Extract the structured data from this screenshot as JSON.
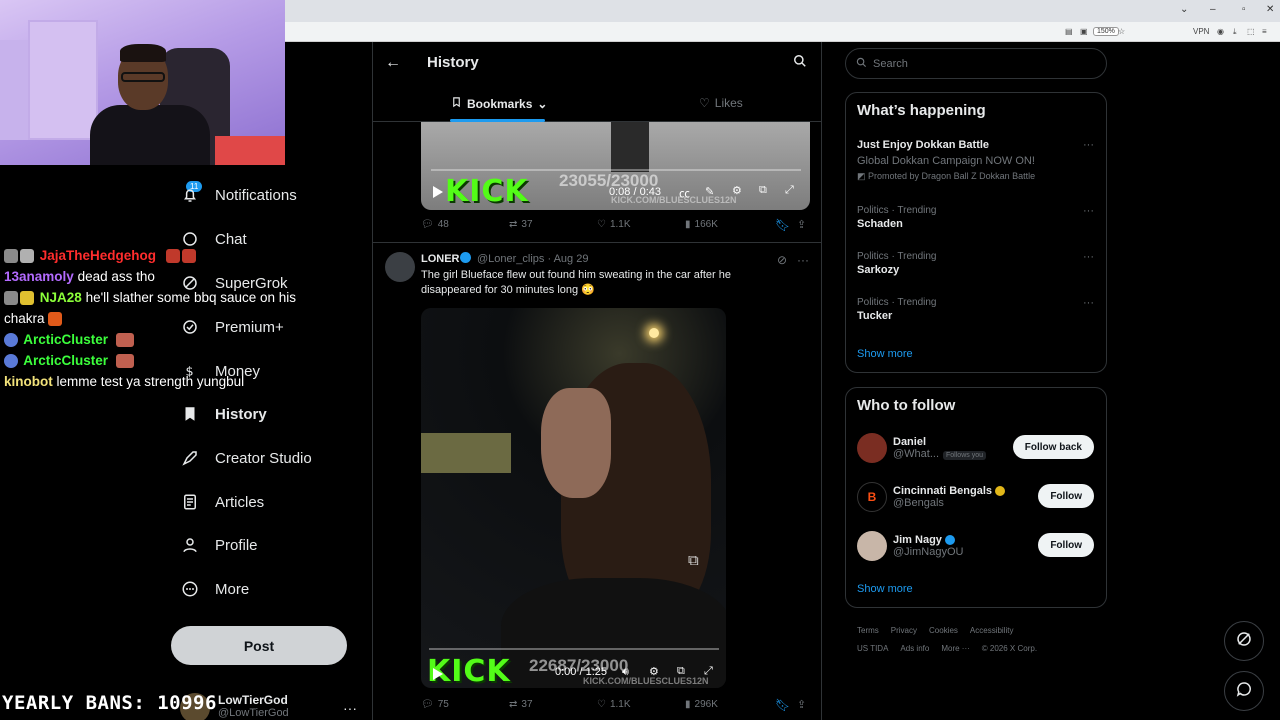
{
  "browser": {
    "zoom": "150%",
    "vpn": "VPN"
  },
  "nav": {
    "notifications_badge": "11",
    "items": [
      {
        "label": "Notifications"
      },
      {
        "label": "Chat"
      },
      {
        "label": "SuperGrok"
      },
      {
        "label": "Premium+"
      },
      {
        "label": "Money"
      },
      {
        "label": "History"
      },
      {
        "label": "Creator Studio"
      },
      {
        "label": "Articles"
      },
      {
        "label": "Profile"
      },
      {
        "label": "More"
      }
    ],
    "post_label": "Post",
    "account_name": "LowTierGod",
    "account_handle": "@LowTierGod"
  },
  "chat": [
    {
      "user": "JajaTheHedgehog",
      "color": "#ff2d2d",
      "msg": ""
    },
    {
      "user": "13anamoly",
      "color": "#b46bff",
      "msg": "dead ass tho"
    },
    {
      "user": "NJA28",
      "color": "#8cff3a",
      "msg": "he'll slather some bbq sauce on his chakra"
    },
    {
      "user": "ArcticCluster",
      "color": "#3cff3c",
      "msg": ""
    },
    {
      "user": "ArcticCluster",
      "color": "#3cff3c",
      "msg": ""
    },
    {
      "user": "kinobot",
      "color": "#f2e27a",
      "msg": "lemme test ya strength yungbul"
    }
  ],
  "bans": "YEARLY BANS: 10996",
  "main": {
    "title": "History",
    "tabs": [
      {
        "label": "Bookmarks"
      },
      {
        "label": "Likes"
      }
    ],
    "tweet1": {
      "overlay_count": "23055/23000",
      "overlay_url": "KICK.COM/BLUESCLUES12N",
      "kick": "KICK",
      "time": "0:08 / 0:43",
      "replies": "48",
      "reposts": "37",
      "likes": "1.1K",
      "views": "166K"
    },
    "tweet2": {
      "name": "LONER",
      "handle": "@Loner_clips · Aug 29",
      "text": "The girl Blueface flew out found him sweating in the car after he disappeared for 30 minutes long 😳",
      "overlay_count": "22687/23000",
      "overlay_url": "KICK.COM/BLUESCLUES12N",
      "kick": "KICK",
      "time": "0:00 / 1:25",
      "replies": "75",
      "reposts": "37",
      "likes": "1.1K",
      "views": "296K"
    }
  },
  "right": {
    "search_placeholder": "Search",
    "whats_happening": "What’s happening",
    "promo": {
      "title": "Just Enjoy Dokkan Battle",
      "sub": "Global Dokkan Campaign NOW ON!",
      "promoted": "Promoted by Dragon Ball Z Dokkan Battle"
    },
    "trends": [
      {
        "context": "Politics · Trending",
        "topic": "Schaden"
      },
      {
        "context": "Politics · Trending",
        "topic": "Sarkozy"
      },
      {
        "context": "Politics · Trending",
        "topic": "Tucker"
      }
    ],
    "show_more": "Show more",
    "who_to_follow": "Who to follow",
    "follow": [
      {
        "name": "Daniel",
        "handle": "@What...",
        "follows_you": "Follows you",
        "button": "Follow back"
      },
      {
        "name": "Cincinnati Bengals",
        "handle": "@Bengals",
        "button": "Follow"
      },
      {
        "name": "Jim Nagy",
        "handle": "@JimNagyOU",
        "button": "Follow"
      }
    ],
    "footer": [
      "Terms",
      "Privacy",
      "Cookies",
      "Accessibility",
      "US TIDA",
      "Ads info",
      "More ···",
      "© 2026 X Corp."
    ]
  },
  "colors": {
    "accent": "#1d9bf0",
    "kick": "#53fc18"
  }
}
